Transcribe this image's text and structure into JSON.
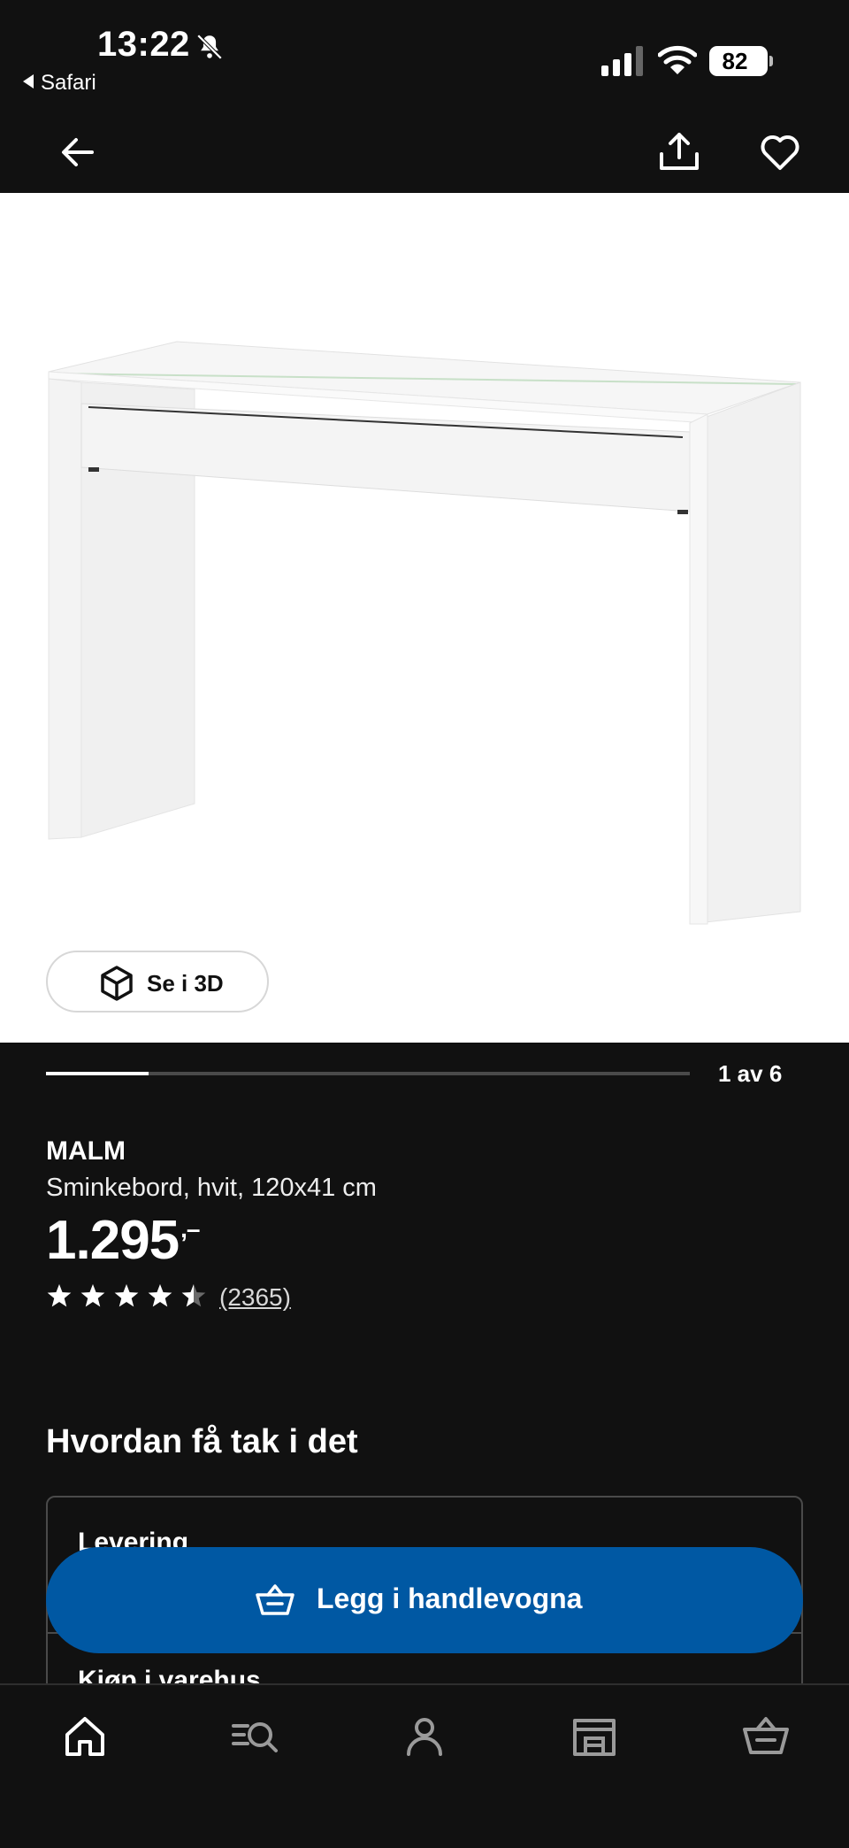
{
  "status_bar": {
    "time": "13:22",
    "back_app": "Safari",
    "battery": "82"
  },
  "gallery": {
    "button_3d": "Se i 3D",
    "counter": "1 av 6",
    "progress": 0.16
  },
  "product": {
    "name": "MALM",
    "description": "Sminkebord, hvit, 120x41 cm",
    "price": "1.295",
    "price_suffix": ",–",
    "rating": 4.5,
    "reviews": "(2365)"
  },
  "availability": {
    "title": "Hvordan få tak i det",
    "delivery": "Levering",
    "store": "Kjøp i varehus"
  },
  "cart_button": "Legg i handlevogna",
  "colors": {
    "accent": "#0058a3",
    "background": "#111111"
  },
  "tabs": [
    "home-icon",
    "search-icon",
    "profile-icon",
    "store-icon",
    "cart-icon"
  ]
}
